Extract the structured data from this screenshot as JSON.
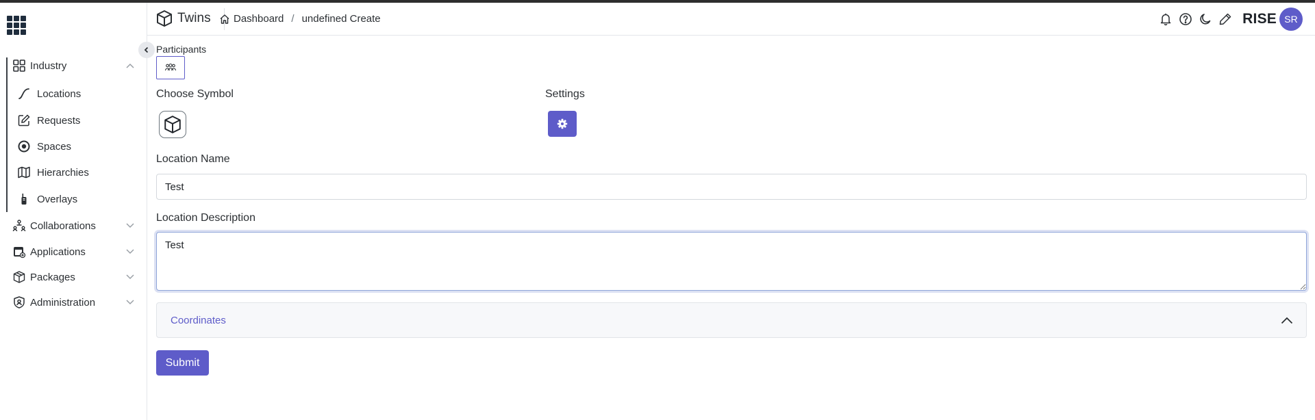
{
  "app": {
    "brand_text": "Twins",
    "product": "RISE",
    "user_initials": "SR",
    "accent_color": "#5e5cc9"
  },
  "breadcrumb": {
    "home": "Dashboard",
    "separator": "/",
    "current": "undefined Create"
  },
  "sidebar": {
    "items": [
      {
        "label": "Industry",
        "icon": "grid-squares-icon",
        "expanded": true
      },
      {
        "label": "Locations",
        "icon": "curve-icon"
      },
      {
        "label": "Requests",
        "icon": "edit-icon"
      },
      {
        "label": "Spaces",
        "icon": "target-circle-icon"
      },
      {
        "label": "Hierarchies",
        "icon": "map-icon"
      },
      {
        "label": "Overlays",
        "icon": "walkie-talkie-icon"
      },
      {
        "label": "Collaborations",
        "icon": "network-users-icon",
        "expanded": false
      },
      {
        "label": "Applications",
        "icon": "app-window-icon",
        "expanded": false
      },
      {
        "label": "Packages",
        "icon": "package-box-icon",
        "expanded": false
      },
      {
        "label": "Administration",
        "icon": "user-shield-icon",
        "expanded": false
      }
    ]
  },
  "form": {
    "participants_label": "Participants",
    "choose_symbol_label": "Choose Symbol",
    "settings_label": "Settings",
    "location_name_label": "Location Name",
    "location_name_value": "Test",
    "location_description_label": "Location Description",
    "location_description_value": "Test",
    "coordinates_label": "Coordinates",
    "submit_label": "Submit"
  }
}
